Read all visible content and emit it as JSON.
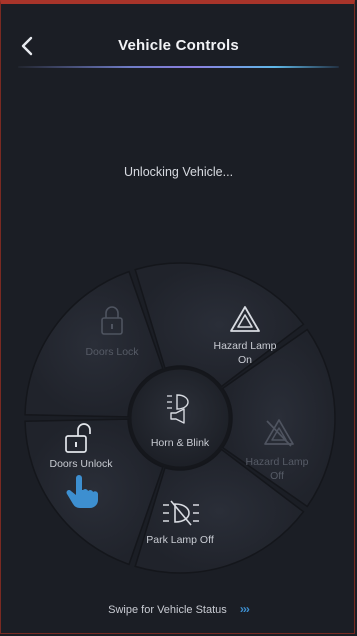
{
  "header": {
    "title": "Vehicle Controls"
  },
  "status_text": "Unlocking Vehicle...",
  "controls": {
    "doors_lock": "Doors Lock",
    "hazard_on_line1": "Hazard Lamp",
    "hazard_on_line2": "On",
    "hazard_off_line1": "Hazard Lamp",
    "hazard_off_line2": "Off",
    "park_lamp_off": "Park Lamp Off",
    "doors_unlock": "Doors Unlock",
    "horn_blink": "Horn & Blink"
  },
  "footer": {
    "swipe_text": "Swipe for Vehicle Status",
    "chevrons": "›››"
  },
  "colors": {
    "accent": "#3d8fd0",
    "background": "#1b1e25"
  }
}
